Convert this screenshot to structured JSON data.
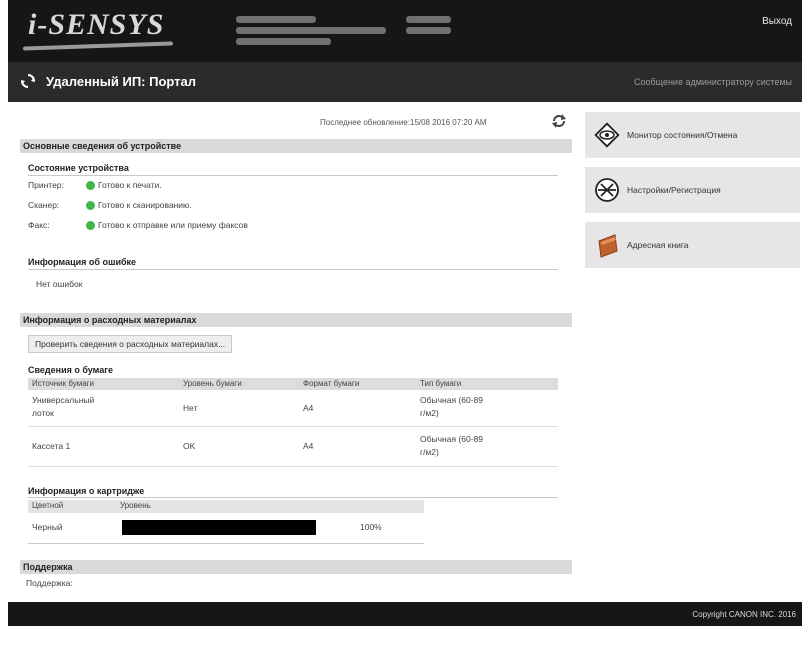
{
  "header": {
    "logo": "i-SENSYS",
    "logout": "Выход"
  },
  "titlebar": {
    "title": "Удаленный ИП: Портал",
    "admin_message": "Сообщение администратору системы"
  },
  "last_update": "Последнее обновление:15/08 2016 07:20 AM",
  "device": {
    "section_title": "Основные сведения об устройстве",
    "status_title": "Состояние устройства",
    "rows": [
      {
        "label": "Принтер:",
        "value": "Готово к печати."
      },
      {
        "label": "Сканер:",
        "value": "Готово к сканированию."
      },
      {
        "label": "Факс:",
        "value": "Готово к отправке или приему факсов"
      }
    ],
    "error_title": "Информация об ошибке",
    "error_value": "Нет ошибок"
  },
  "consumables": {
    "section_title": "Информация о расходных материалах",
    "check_button": "Проверить сведения о расходных материалах...",
    "paper_title": "Сведения о бумаге",
    "columns": [
      "Источник бумаги",
      "Уровень бумаги",
      "Формат бумаги",
      "Тип бумаги"
    ],
    "rows": [
      {
        "source1": "Универсальный",
        "source2": "лоток",
        "level": "Нет",
        "format": "A4",
        "type1": "Обычная (60-89",
        "type2": "г/м2)"
      },
      {
        "source1": "Кассета 1",
        "source2": "",
        "level": "OK",
        "format": "A4",
        "type1": "Обычная (60-89",
        "type2": "г/м2)"
      }
    ],
    "cartridge_title": "Информация о картридже",
    "cartridge_columns": [
      "Цветной",
      "Уровень"
    ],
    "cartridge_rows": [
      {
        "color": "Черный",
        "level_text": "100%",
        "level": 100
      }
    ]
  },
  "support": {
    "section_title": "Поддержка",
    "label": "Поддержка:"
  },
  "sidebar": {
    "items": [
      {
        "label": "Монитор состояния/Отмена",
        "icon": "eye-monitor-icon"
      },
      {
        "label": "Настройки/Регистрация",
        "icon": "settings-icon"
      },
      {
        "label": "Адресная книга",
        "icon": "address-book-icon"
      }
    ]
  },
  "footer": {
    "copyright": "Copyright CANON INC. 2016"
  },
  "colors": {
    "status_ok": "#3fb54a",
    "header_bg": "#161616",
    "titlebar_bg": "#2b2b2b"
  }
}
